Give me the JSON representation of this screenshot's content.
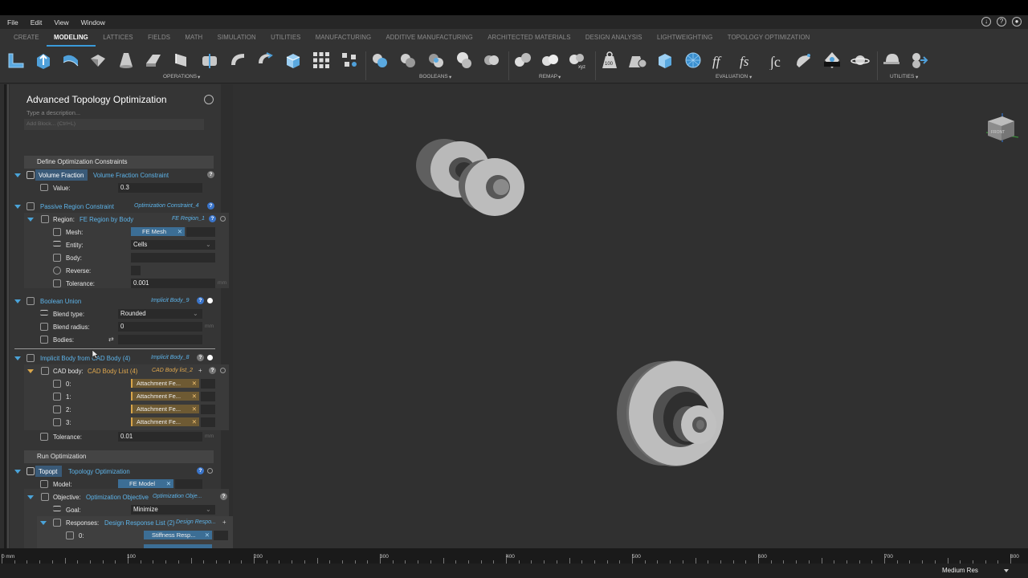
{
  "menu": [
    "File",
    "Edit",
    "View",
    "Window"
  ],
  "tabs": [
    {
      "label": "CREATE",
      "active": false
    },
    {
      "label": "MODELING",
      "active": true
    },
    {
      "label": "LATTICES",
      "active": false
    },
    {
      "label": "FIELDS",
      "active": false
    },
    {
      "label": "MATH",
      "active": false
    },
    {
      "label": "SIMULATION",
      "active": false
    },
    {
      "label": "UTILITIES",
      "active": false
    },
    {
      "label": "MANUFACTURING",
      "active": false
    },
    {
      "label": "ADDITIVE MANUFACTURING",
      "active": false
    },
    {
      "label": "ARCHITECTED MATERIALS",
      "active": false
    },
    {
      "label": "DESIGN ANALYSIS",
      "active": false
    },
    {
      "label": "LIGHTWEIGHTING",
      "active": false
    },
    {
      "label": "TOPOLOGY OPTIMIZATION",
      "active": false
    }
  ],
  "toolbar_groups": {
    "operations": "OPERATIONS",
    "booleans": "BOOLEANS",
    "remap": "REMAP",
    "evaluation": "EVALUATION",
    "utilities": "UTILITIES"
  },
  "toolbar_badges": {
    "hundred": "100",
    "xyz": "xyz",
    "integral": "∫c"
  },
  "panel": {
    "title": "Advanced Topology Optimization",
    "description_placeholder": "Type a description...",
    "add_block_placeholder": "Add Block... (Ctrl+L)",
    "section1": "Define Optimization Constraints",
    "volume_fraction": {
      "name": "Volume Fraction",
      "type": "Volume Fraction Constraint",
      "value_label": "Value:",
      "value": "0.3"
    },
    "passive_region": {
      "name": "Passive Region Constraint",
      "output": "Optimization Constraint_4",
      "region_label": "Region:",
      "region_type": "FE Region by Body",
      "region_output": "FE Region_1",
      "mesh_label": "Mesh:",
      "mesh_value": "FE Mesh",
      "entity_label": "Entity:",
      "entity_value": "Cells",
      "body_label": "Body:",
      "reverse_label": "Reverse:",
      "tolerance_label": "Tolerance:",
      "tolerance_value": "0.001",
      "unit": "mm"
    },
    "boolean_union": {
      "name": "Boolean Union",
      "output": "Implicit Body_9",
      "blend_type_label": "Blend type:",
      "blend_type_value": "Rounded",
      "blend_radius_label": "Blend radius:",
      "blend_radius_value": "0",
      "bodies_label": "Bodies:",
      "unit": "mm"
    },
    "implicit_body": {
      "name": "Implicit Body from CAD Body (4)",
      "output": "Implicit Body_8",
      "cad_label": "CAD body:",
      "cad_type": "CAD Body List (4)",
      "cad_output": "CAD Body list_2",
      "items": [
        {
          "index": "0:",
          "value": "Attachment Fe..."
        },
        {
          "index": "1:",
          "value": "Attachment Fe..."
        },
        {
          "index": "2:",
          "value": "Attachment Fe..."
        },
        {
          "index": "3:",
          "value": "Attachment Fe..."
        }
      ],
      "tolerance_label": "Tolerance:",
      "tolerance_value": "0.01",
      "unit": "mm"
    },
    "section2": "Run Optimization",
    "topopt": {
      "name": "Topopt",
      "type": "Topology Optimization",
      "model_label": "Model:",
      "model_value": "FE Model",
      "objective_label": "Objective:",
      "objective_type": "Optimization Objective",
      "objective_output": "Optimization Obje...",
      "goal_label": "Goal:",
      "goal_value": "Minimize",
      "responses_label": "Responses:",
      "responses_type": "Design Response List (2)",
      "responses_output": "Design Respo...",
      "response0_index": "0:",
      "response0_value": "Stiffness Resp..."
    }
  },
  "ruler": {
    "labels": [
      "0 mm",
      "100",
      "200",
      "300",
      "400",
      "500",
      "600",
      "700",
      "800"
    ]
  },
  "status": {
    "resolution": "Medium Res"
  },
  "view_cube_label": "FRONT",
  "colors": {
    "accent": "#3a9ad9",
    "chip_blue": "#3c6e95",
    "chip_gold": "#d8a54a",
    "background": "#2e2e2e"
  }
}
